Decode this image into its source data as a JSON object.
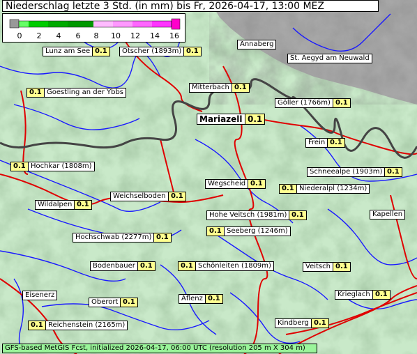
{
  "title": "Niederschlag letzte 3 Std. (in mm) bis Fr, 2026-04-17, 13:00 MEZ",
  "legend": {
    "ticks": [
      "0",
      "2",
      "4",
      "6",
      "8",
      "10",
      "12",
      "14",
      "16"
    ],
    "colors": [
      "#999999",
      "#66ff66",
      "#00cc00",
      "#00aa00",
      "#009900",
      "#ff99ff",
      "#ff66ff",
      "#ff33ff",
      "#ff00ff"
    ]
  },
  "locations": [
    {
      "name": "Lunz am See",
      "value": "0.1"
    },
    {
      "name": "Ötscher (1893m)",
      "value": "0.1"
    },
    {
      "name": "Annaberg",
      "value": ""
    },
    {
      "name": "St. Aegyd am Neuwald",
      "value": ""
    },
    {
      "name": "Goestling an der Ybbs",
      "value": "0.1"
    },
    {
      "name": "Mitterbach",
      "value": "0.1"
    },
    {
      "name": "Göller (1766m)",
      "value": "0.1"
    },
    {
      "name": "Mariazell",
      "value": "0.1"
    },
    {
      "name": "Frein",
      "value": "0.1"
    },
    {
      "name": "Hochkar (1808m)",
      "value": "0.1"
    },
    {
      "name": "Schneealpe (1903m)",
      "value": "0.1"
    },
    {
      "name": "Wegscheid",
      "value": "0.1"
    },
    {
      "name": "Niederalpl (1234m)",
      "value": "0.1"
    },
    {
      "name": "Weichselboden",
      "value": "0.1"
    },
    {
      "name": "Wildalpen",
      "value": "0.1"
    },
    {
      "name": "Hohe Veitsch (1981m)",
      "value": "0.1"
    },
    {
      "name": "Kapellen",
      "value": ""
    },
    {
      "name": "Seeberg (1246m)",
      "value": "0.1"
    },
    {
      "name": "Hochschwab (2277m)",
      "value": "0.1"
    },
    {
      "name": "Bodenbauer",
      "value": "0.1"
    },
    {
      "name": "Schönleiten (1809m)",
      "value": "0.1"
    },
    {
      "name": "Veitsch",
      "value": "0.1"
    },
    {
      "name": "Eisenerz",
      "value": ""
    },
    {
      "name": "Oberort",
      "value": "0.1"
    },
    {
      "name": "Aflenz",
      "value": "0.1"
    },
    {
      "name": "Krieglach",
      "value": "0.1"
    },
    {
      "name": "Reichenstein (2165m)",
      "value": "0.1"
    },
    {
      "name": "Kindberg",
      "value": "0.1"
    }
  ],
  "footer": "GFS-based MetGIS Fcst, initialized 2026-04-17, 06:00 UTC  (resolution 205 m X 304 m)"
}
